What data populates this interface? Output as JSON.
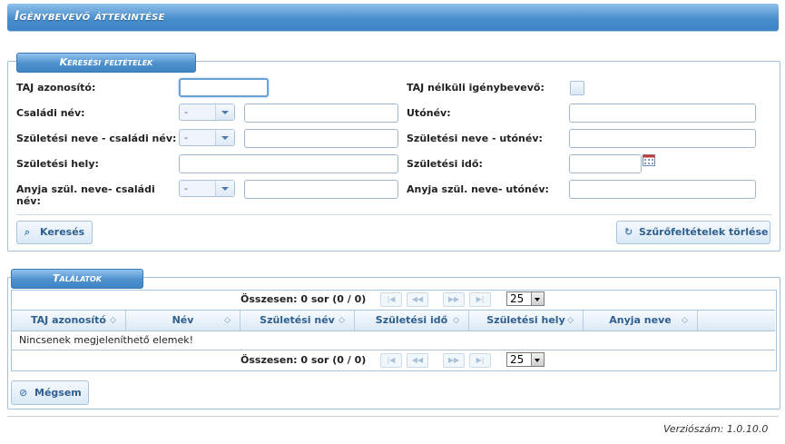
{
  "title": "Igénybevevő áttekintése",
  "search": {
    "legend": "Keresési feltételek",
    "taj_label": "TAJ azonosító:",
    "no_taj_label": "TAJ nélküli igénybevevő:",
    "family_name_label": "Családi név:",
    "given_name_label": "Utónév:",
    "birth_family_label": "Születési neve - családi név:",
    "birth_given_label": "Születési neve - utónév:",
    "birth_place_label": "Születési hely:",
    "birth_date_label": "Születési idő:",
    "mother_family_label": "Anyja szül. neve- családi név:",
    "mother_given_label": "Anyja szül. neve- utónév:",
    "select_default": "-",
    "search_button": "Keresés",
    "clear_button": "Szűrőfeltételek törlése"
  },
  "results": {
    "legend": "Találatok",
    "summary_top": "Összesen: 0 sor (0 / 0)",
    "summary_bottom": "Összesen: 0 sor (0 / 0)",
    "rows_per_page": "25",
    "columns": [
      "TAJ azonosító",
      "Név",
      "Születési név",
      "Születési idő",
      "Születési hely",
      "Anyja neve"
    ],
    "empty_message": "Nincsenek megjeleníthető elemek!",
    "pager_first": "|◀",
    "pager_prev": "◀◀",
    "pager_next": "▶▶",
    "pager_last": "▶|"
  },
  "cancel_button": "Mégsem",
  "version": "Verziószám: 1.0.10.0",
  "icons": {
    "search": "magnifier-icon",
    "clear": "refresh-icon",
    "cancel": "cancel-icon",
    "calendar": "calendar-icon"
  },
  "colors": {
    "header_blue": "#4a8fcc",
    "border_blue": "#9fc1de",
    "text_blue": "#2f5f8f"
  }
}
